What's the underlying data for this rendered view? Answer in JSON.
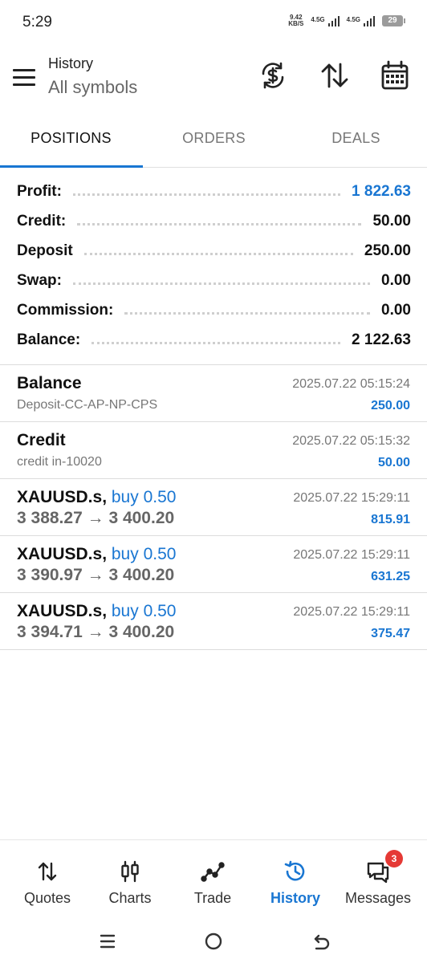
{
  "status": {
    "time": "5:29",
    "net_speed_value": "9.42",
    "net_speed_unit": "KB/S",
    "signal1_label": "4.5G",
    "signal2_label": "4.5G",
    "battery": "29"
  },
  "appbar": {
    "title": "History",
    "subtitle": "All symbols",
    "icons": [
      "menu-icon",
      "currency-exchange-icon",
      "sort-icon",
      "calendar-icon"
    ]
  },
  "tabs": [
    {
      "label": "POSITIONS",
      "active": true
    },
    {
      "label": "ORDERS",
      "active": false
    },
    {
      "label": "DEALS",
      "active": false
    }
  ],
  "summary": [
    {
      "label": "Profit:",
      "value": "1 822.63",
      "color": "#1976d2"
    },
    {
      "label": "Credit:",
      "value": "50.00"
    },
    {
      "label": "Deposit",
      "value": "250.00"
    },
    {
      "label": "Swap:",
      "value": "0.00"
    },
    {
      "label": "Commission:",
      "value": "0.00"
    },
    {
      "label": "Balance:",
      "value": "2 122.63"
    }
  ],
  "history": [
    {
      "title": "Balance",
      "subtitle": "Deposit-CC-AP-NP-CPS",
      "time": "2025.07.22 05:15:24",
      "amount": "250.00"
    },
    {
      "title": "Credit",
      "subtitle": "credit in-10020",
      "time": "2025.07.22 05:15:32",
      "amount": "50.00"
    },
    {
      "symbol": "XAUUSD.s,",
      "side": "buy 0.50",
      "open": "3 388.27",
      "arrow": "→",
      "close": "3 400.20",
      "time": "2025.07.22 15:29:11",
      "amount": "815.91"
    },
    {
      "symbol": "XAUUSD.s,",
      "side": "buy 0.50",
      "open": "3 390.97",
      "arrow": "→",
      "close": "3 400.20",
      "time": "2025.07.22 15:29:11",
      "amount": "631.25"
    },
    {
      "symbol": "XAUUSD.s,",
      "side": "buy 0.50",
      "open": "3 394.71",
      "arrow": "→",
      "close": "3 400.20",
      "time": "2025.07.22 15:29:11",
      "amount": "375.47"
    }
  ],
  "bottom_nav": [
    {
      "label": "Quotes",
      "icon": "quotes-icon"
    },
    {
      "label": "Charts",
      "icon": "charts-icon"
    },
    {
      "label": "Trade",
      "icon": "trade-icon"
    },
    {
      "label": "History",
      "icon": "history-icon",
      "active": true
    },
    {
      "label": "Messages",
      "icon": "messages-icon",
      "badge": "3"
    }
  ],
  "colors": {
    "accent": "#1976d2",
    "badge": "#e53935"
  }
}
